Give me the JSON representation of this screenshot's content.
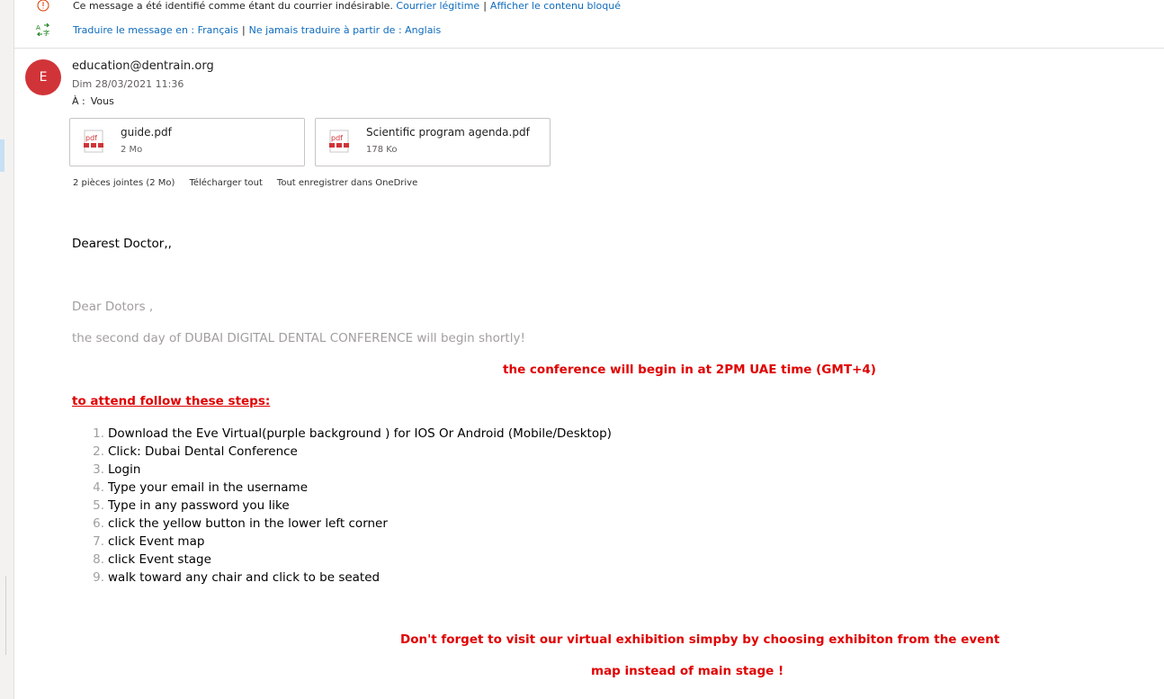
{
  "notice": {
    "junk_text": "Ce message a été identifié comme étant du courrier indésirable.",
    "legit_link": "Courrier légitime",
    "separator": "|",
    "blocked_link": "Afficher le contenu bloqué",
    "translate_link": "Traduire le message en : Français",
    "never_translate_link": "Ne jamais traduire à partir de : Anglais"
  },
  "header": {
    "avatar_initial": "E",
    "sender": "education@dentrain.org",
    "date": "Dim 28/03/2021 11:36",
    "to_label": "À :",
    "to_value": "Vous"
  },
  "attachments": [
    {
      "icon": "pdf-icon",
      "name": "guide.pdf",
      "size": "2 Mo"
    },
    {
      "icon": "pdf-icon",
      "name": "Scientific program agenda.pdf",
      "size": "178 Ko"
    }
  ],
  "attachment_bar": {
    "summary": "2 pièces jointes (2 Mo)",
    "download_all": "Télécharger tout",
    "save_onedrive": "Tout enregistrer dans OneDrive"
  },
  "body": {
    "greeting": "Dearest Doctor,,",
    "dear": "Dear Dotors ,",
    "intro": "the second day of DUBAI DIGITAL DENTAL CONFERENCE will begin shortly!",
    "begin_time": "the conference will begin in at 2PM UAE time (GMT+4)",
    "steps_heading": "to attend follow these steps:",
    "steps": [
      {
        "n": "1.",
        "text": "Download the Eve Virtual(purple background ) for IOS Or Android (Mobile/Desktop)"
      },
      {
        "n": "2.",
        "text": "Click: Dubai Dental Conference"
      },
      {
        "n": "3.",
        "text": "Login"
      },
      {
        "n": "4.",
        "text": "Type your email in the username"
      },
      {
        "n": "5.",
        "text": "Type in any password you like"
      },
      {
        "n": "6.",
        "text": "click the yellow button in the lower left corner"
      },
      {
        "n": "7.",
        "text": "click Event map"
      },
      {
        "n": "8.",
        "text": "click Event stage"
      },
      {
        "n": "9.",
        "text": "walk toward any chair and click to be seated"
      }
    ],
    "exhibition_line1": "Don't forget to visit our virtual exhibition simpby by choosing exhibiton from the event",
    "exhibition_line2": "map instead of main stage !"
  },
  "colors": {
    "accent_link": "#0f6cbd",
    "avatar": "#d13438",
    "emphasis_red": "#e00000"
  }
}
